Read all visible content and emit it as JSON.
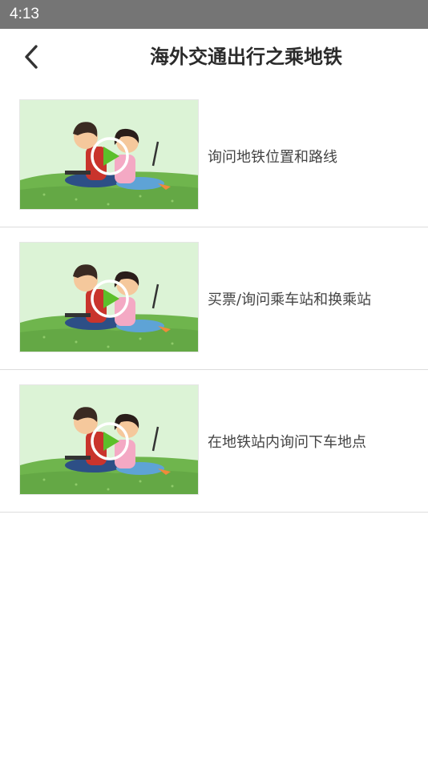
{
  "status_bar": {
    "time": "4:13"
  },
  "header": {
    "back_icon": "chevron-left-icon",
    "title": "海外交通出行之乘地铁"
  },
  "videos": [
    {
      "label": "询问地铁位置和路线",
      "thumbnail_icon": "play-icon"
    },
    {
      "label": "买票/询问乘车站和换乘站",
      "thumbnail_icon": "play-icon"
    },
    {
      "label": "在地铁站内询问下车地点",
      "thumbnail_icon": "play-icon"
    }
  ],
  "colors": {
    "status_bar": "#757575",
    "thumbnail_sky": "#dcf3d6",
    "thumbnail_grass": "#6fb54d",
    "play_triangle": "#5cbf2a"
  }
}
